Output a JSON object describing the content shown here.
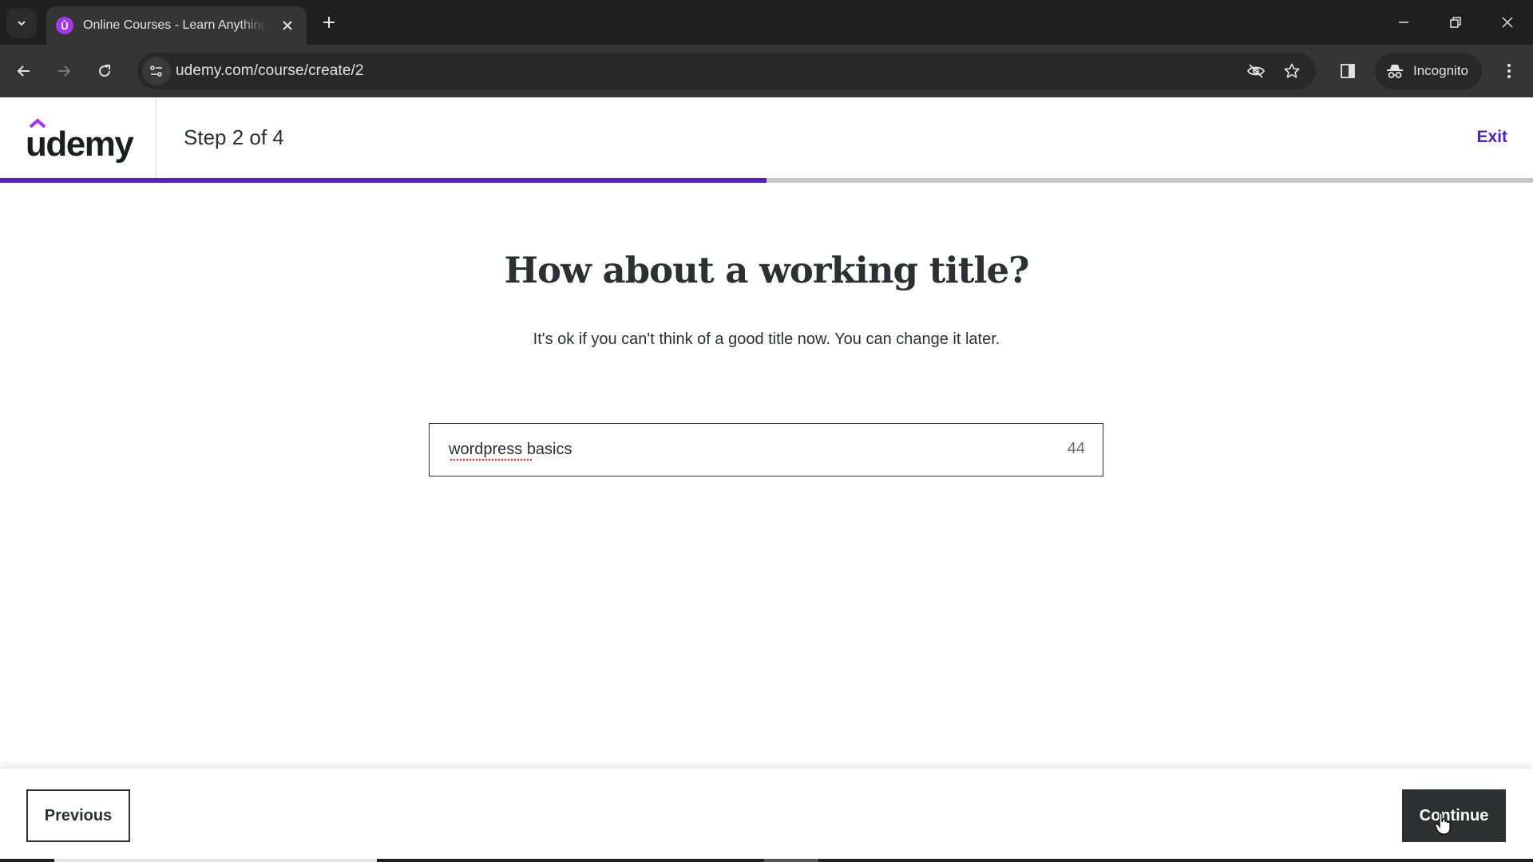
{
  "browser": {
    "tab": {
      "title": "Online Courses - Learn Anything",
      "favicon_letter": "Û",
      "favicon_color": "#a435f0"
    },
    "url": "udemy.com/course/create/2",
    "incognito_label": "Incognito",
    "icons": [
      "tab-search-icon",
      "close-icon",
      "new-tab-icon",
      "minimize-icon",
      "restore-icon",
      "window-close-icon",
      "back-icon",
      "forward-icon",
      "reload-icon",
      "site-info-icon",
      "eye-off-icon",
      "star-icon",
      "side-panel-icon",
      "incognito-icon",
      "more-menu-icon"
    ]
  },
  "header": {
    "logo_text": "udemy",
    "step_label": "Step 2 of 4",
    "exit_label": "Exit",
    "accent_color": "#5022c3"
  },
  "progress": {
    "current_step": 2,
    "total_steps": 4,
    "fraction": 0.5
  },
  "main": {
    "title": "How about a working title?",
    "subtitle": "It's ok if you can't think of a good title now. You can change it later.",
    "title_input": {
      "value": "wordpress basics",
      "remaining_chars": "44"
    }
  },
  "footer": {
    "previous_label": "Previous",
    "continue_label": "Continue"
  }
}
